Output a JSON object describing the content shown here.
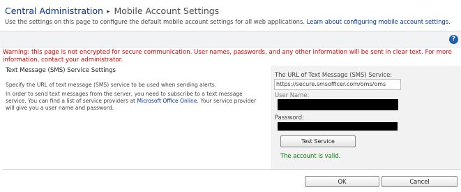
{
  "breadcrumb": {
    "root": "Central Administration",
    "separator": "▸",
    "current": "Mobile Account Settings"
  },
  "description": {
    "text": "Use the settings on this page to configure the default mobile account settings for all web applications.",
    "link": "Learn about configuring mobile account settings."
  },
  "help": {
    "icon": "help-icon",
    "glyph": "?"
  },
  "warning": "Warning: this page is not encrypted for secure communication. User names, passwords, and any other information will be sent in clear text. For more information, contact your administrator.",
  "section": {
    "title": "Text Message (SMS) Service Settings",
    "desc1": "Specify the URL of text message (SMS) service to be used when sending alerts.",
    "desc2_pre": "In order to send text messages from the server, you need to subscribe to a text message service. You can find a list of service providers at ",
    "desc2_link": "Microsoft Office Online",
    "desc2_post": ". Your service provider will give you a user name and password."
  },
  "form": {
    "url_label": "The URL of Text Message (SMS) Service:",
    "url_value": "https://secure.smsofficer.com/oms/oms",
    "user_label": "User Name:",
    "password_label": "Password:",
    "test_button": "Test Service",
    "valid_message": "The account is valid."
  },
  "footer": {
    "ok": "OK",
    "cancel": "Cancel"
  },
  "colors": {
    "link": "#003399",
    "warning": "#e00000",
    "success": "#008000",
    "pane": "#f2f2f2"
  }
}
